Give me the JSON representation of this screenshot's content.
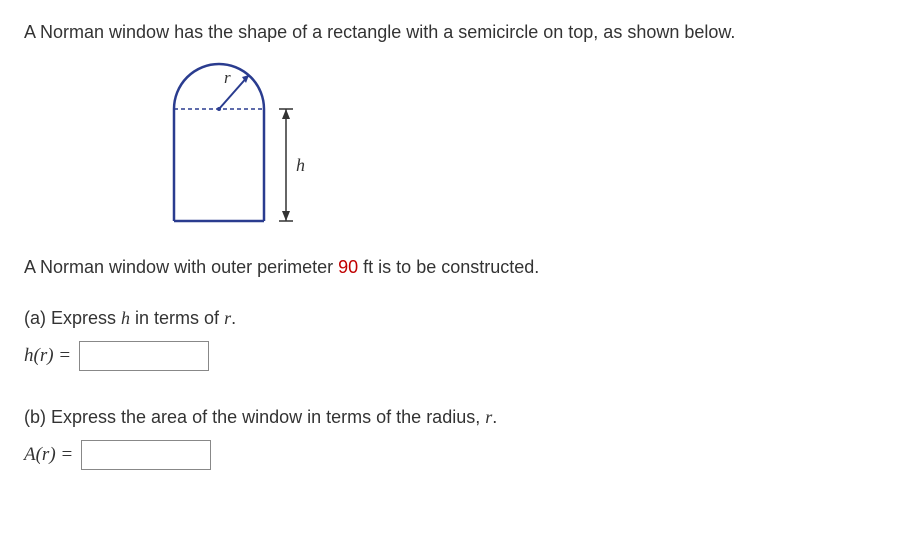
{
  "intro": "A Norman window has the shape of a rectangle with a semicircle on top, as shown below.",
  "perimeter_prefix": "A Norman window with outer perimeter ",
  "perimeter_value": "90",
  "perimeter_suffix": " ft is to be constructed.",
  "part_a": {
    "prompt_prefix": "(a) Express ",
    "var1": "h",
    "prompt_mid": " in terms of ",
    "var2": "r",
    "prompt_suffix": ".",
    "label": "h(r) ="
  },
  "part_b": {
    "prompt_prefix": "(b) Express the area of the window in terms of the radius, ",
    "var": "r",
    "prompt_suffix": ".",
    "label": "A(r) ="
  },
  "diagram": {
    "r_label": "r",
    "h_label": "h"
  }
}
